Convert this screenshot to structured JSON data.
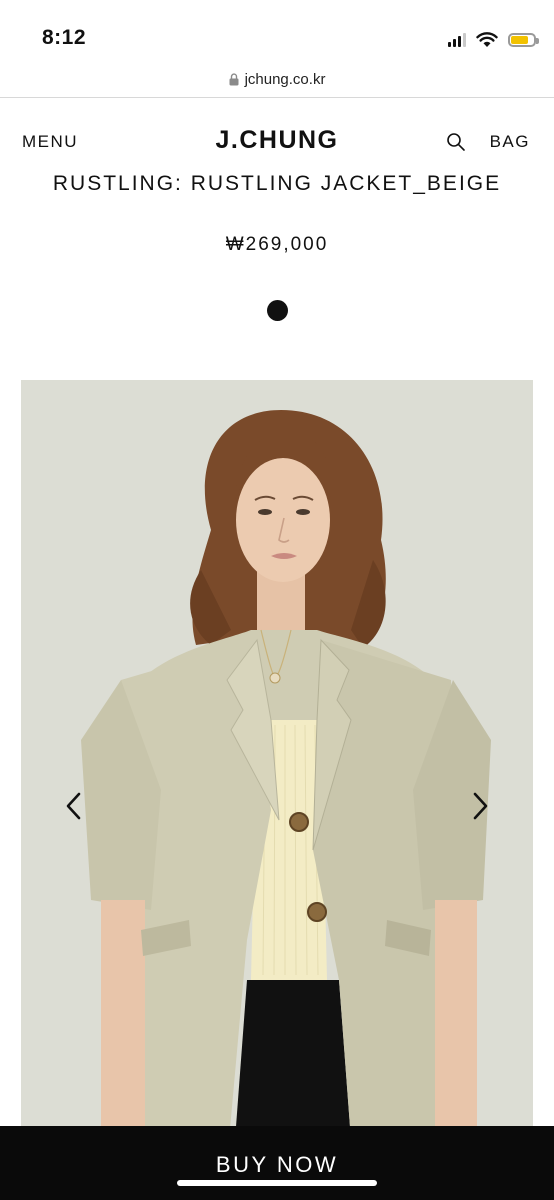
{
  "status_bar": {
    "time": "8:12",
    "battery_level": 0.8,
    "battery_color": "#f2c200",
    "icons": [
      "signal-icon",
      "wifi-icon",
      "battery-icon"
    ]
  },
  "browser": {
    "url": "jchung.co.kr",
    "secure_icon": "lock-icon"
  },
  "header": {
    "menu_label": "MENU",
    "logo": "J.CHUNG",
    "search_icon": "search-icon",
    "bag_label": "BAG"
  },
  "product": {
    "title": "RUSTLING: RUSTLING JACKET_BEIGE",
    "price": "₩269,000",
    "color_swatch": "#111111",
    "image_alt": "model wearing beige short-sleeve jacket",
    "prev_icon": "chevron-left-icon",
    "next_icon": "chevron-right-icon"
  },
  "cta": {
    "buy_label": "BUY NOW",
    "background": "#0a0a0a"
  }
}
